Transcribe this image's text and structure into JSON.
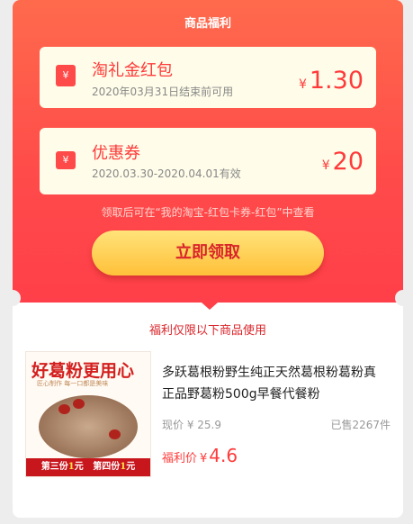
{
  "header": {
    "title": "商品福利"
  },
  "coupon_red": {
    "icon": "red-envelope-icon",
    "icon_glyph": "¥",
    "title": "淘礼金红包",
    "subtitle": "2020年03月31日结束前可用",
    "currency": "¥",
    "amount": "1.30"
  },
  "coupon_discount": {
    "icon": "ticket-icon",
    "icon_glyph": "¥",
    "title": "优惠券",
    "subtitle": "2020.03.30-2020.04.01有效",
    "currency": "¥",
    "amount": "20"
  },
  "notice": "领取后可在“我的淘宝-红包卡券-红包”中查看",
  "claim_button": "立即领取",
  "limit_text": "福利仅限以下商品使用",
  "product": {
    "image_text": {
      "headline": "好葛粉更用心",
      "tagline": "匠心制作  每一口都是美味",
      "promo_a": "第三份",
      "promo_a_num": "1",
      "promo_a_unit": "元",
      "promo_b": "第四份",
      "promo_b_num": "1",
      "promo_b_unit": "元"
    },
    "name": "多跃葛根粉野生纯正天然葛根粉葛粉真正品野葛粉500g早餐代餐粉",
    "current_price": "现价 ¥ 25.9",
    "sold": "已售2267件",
    "welfare_label": "福利价",
    "welfare_currency": "¥",
    "welfare_price": "4.6"
  },
  "colors": {
    "accent_red": "#ff3a3a",
    "gradient_top": "#ff6a4c",
    "button_yellow": "#ffc039"
  }
}
